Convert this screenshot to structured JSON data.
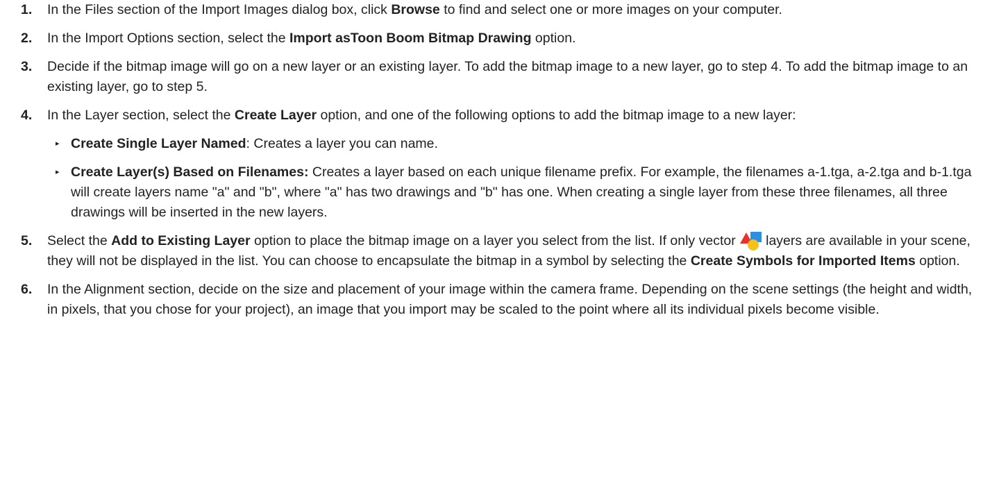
{
  "steps": [
    {
      "num": "1.",
      "pre": "In the Files section of the Import Images dialog box, click ",
      "bold": "Browse",
      "post": " to find and select one or more images on your computer."
    },
    {
      "num": "2.",
      "pre": "In the Import Options section, select the ",
      "bold": "Import asToon Boom Bitmap Drawing",
      "post": " option."
    },
    {
      "num": "3.",
      "text": "Decide if the bitmap image will go on a new layer or an existing layer. To add the bitmap image to a new layer, go to step 4. To add the bitmap image to an existing layer, go to step 5."
    },
    {
      "num": "4.",
      "pre": "In the Layer section, select the ",
      "bold": "Create Layer",
      "post": " option, and one of the following options to add the bitmap image to a new layer:",
      "bullets": [
        {
          "marker": "▸",
          "bold": "Create Single Layer Named",
          "post": ": Creates a layer you can name."
        },
        {
          "marker": "▸",
          "bold": "Create Layer(s) Based on Filenames:",
          "post": " Creates a layer based on each unique filename prefix. For example, the filenames a-1.tga, a-2.tga and b-1.tga will create layers name \"a\" and \"b\", where \"a\" has two drawings and \"b\" has one. When creating a single layer from these three filenames, all three drawings will be inserted in the new layers."
        }
      ]
    },
    {
      "num": "5.",
      "pre": "Select the ",
      "bold": "Add to Existing Layer",
      "mid": " option to place the bitmap image on a layer you select from the list. If only vector ",
      "icon": "vector-layer-icon",
      "mid2": "layers are available in your scene, they will not be displayed in the list. You can choose to encapsulate the bitmap in a symbol by selecting the ",
      "bold2": "Create Symbols for Imported Items",
      "post": " option."
    },
    {
      "num": "6.",
      "text": "In the Alignment section, decide on the size and placement of your image within the camera frame. Depending on the scene settings (the height and width, in pixels, that you chose for your project), an image that you import may be scaled to the point where all its individual pixels become visible."
    }
  ],
  "colors": {
    "text": "#222222",
    "icon_red": "#e8322d",
    "icon_blue": "#2f8ee0",
    "icon_yellow": "#f5c21b"
  }
}
